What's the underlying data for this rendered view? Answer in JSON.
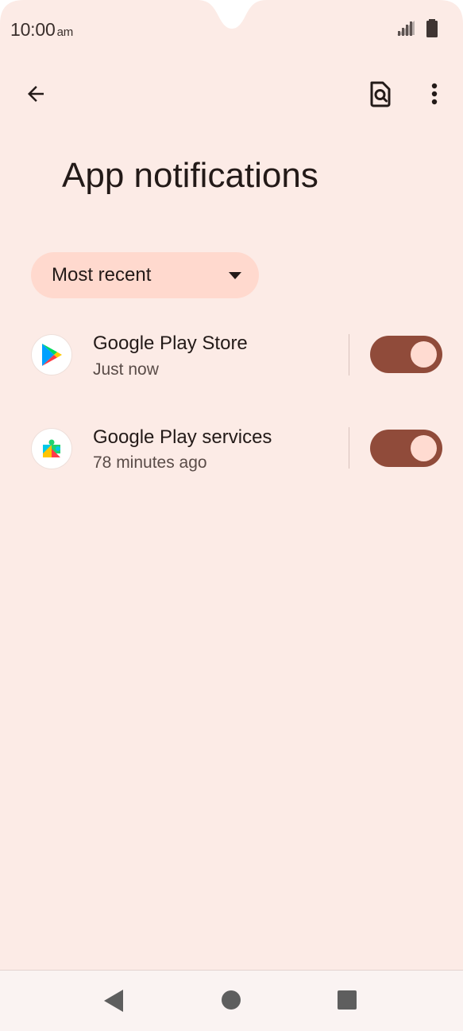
{
  "status_bar": {
    "time": "10:00",
    "ampm": "am"
  },
  "toolbar": {
    "back_icon": "arrow-back-icon",
    "search_icon": "search-settings-icon",
    "more_icon": "more-vert-icon"
  },
  "page": {
    "title": "App notifications"
  },
  "sort": {
    "selected": "Most recent",
    "caret_icon": "dropdown-arrow-icon"
  },
  "apps": [
    {
      "name": "Google Play Store",
      "time": "Just now",
      "enabled": true,
      "icon": "google-play-store-icon"
    },
    {
      "name": "Google Play services",
      "time": "78 minutes ago",
      "enabled": true,
      "icon": "google-play-services-icon"
    }
  ],
  "colors": {
    "background": "#fcebe6",
    "chip": "#ffd9ce",
    "toggle_track": "#904b3a",
    "toggle_knob": "#ffdbd1"
  },
  "nav": {
    "back_icon": "nav-back-icon",
    "home_icon": "nav-home-icon",
    "recents_icon": "nav-recents-icon"
  }
}
